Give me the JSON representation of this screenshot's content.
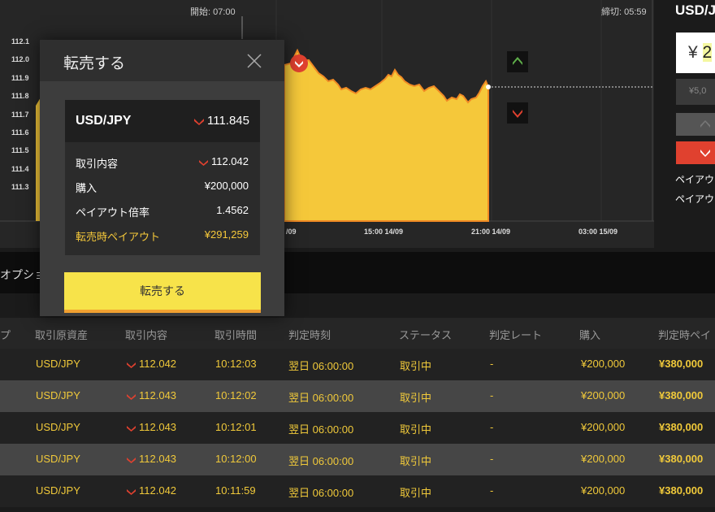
{
  "chart": {
    "start_label": "開始: 07:00",
    "end_label": "締切: 05:59",
    "y_ticks": [
      "112.1",
      "112.0",
      "111.9",
      "111.8",
      "111.7",
      "111.6",
      "111.5",
      "111.4",
      "111.3"
    ],
    "x_ticks": [
      "/09",
      "15:00 14/09",
      "21:00 14/09",
      "03:00 15/09"
    ],
    "fill_color": "#f5c83a",
    "line_color": "#f08a24"
  },
  "right_panel": {
    "pair_title": "USD/J",
    "amount_prefix": "¥",
    "amount_value": "2",
    "small_amount": "¥5,0",
    "payout_line_1": "ペイアウ",
    "payout_line_2": "ペイアウ"
  },
  "options_bar": {
    "title": "オプショ"
  },
  "table": {
    "headers": [
      "プ",
      "取引原資産",
      "取引内容",
      "取引時間",
      "判定時刻",
      "ステータス",
      "判定レート",
      "購入",
      "判定時ペイ"
    ],
    "rows": [
      {
        "asset": "USD/JPY",
        "rate": "112.042",
        "time": "10:12:03",
        "judge": "翌日 06:00:00",
        "status": "取引中",
        "judge_rate": "-",
        "purchase": "¥200,000",
        "payout": "¥380,000"
      },
      {
        "asset": "USD/JPY",
        "rate": "112.043",
        "time": "10:12:02",
        "judge": "翌日 06:00:00",
        "status": "取引中",
        "judge_rate": "-",
        "purchase": "¥200,000",
        "payout": "¥380,000"
      },
      {
        "asset": "USD/JPY",
        "rate": "112.043",
        "time": "10:12:01",
        "judge": "翌日 06:00:00",
        "status": "取引中",
        "judge_rate": "-",
        "purchase": "¥200,000",
        "payout": "¥380,000"
      },
      {
        "asset": "USD/JPY",
        "rate": "112.043",
        "time": "10:12:00",
        "judge": "翌日 06:00:00",
        "status": "取引中",
        "judge_rate": "-",
        "purchase": "¥200,000",
        "payout": "¥380,000"
      },
      {
        "asset": "USD/JPY",
        "rate": "112.042",
        "time": "10:11:59",
        "judge": "翌日 06:00:00",
        "status": "取引中",
        "judge_rate": "-",
        "purchase": "¥200,000",
        "payout": "¥380,000"
      }
    ]
  },
  "modal": {
    "title": "転売する",
    "pair": "USD/JPY",
    "current_rate": "111.845",
    "trade_label": "取引内容",
    "trade_value": "112.042",
    "purchase_label": "購入",
    "purchase_value": "¥200,000",
    "payout_rate_label": "ペイアウト倍率",
    "payout_rate_value": "1.4562",
    "resale_payout_label": "転売時ペイアウト",
    "resale_payout_value": "¥291,259",
    "button_label": "転売する"
  },
  "colors": {
    "accent_yellow": "#f5c83a",
    "down_red": "#e0412f",
    "up_green": "#5fb04a"
  }
}
